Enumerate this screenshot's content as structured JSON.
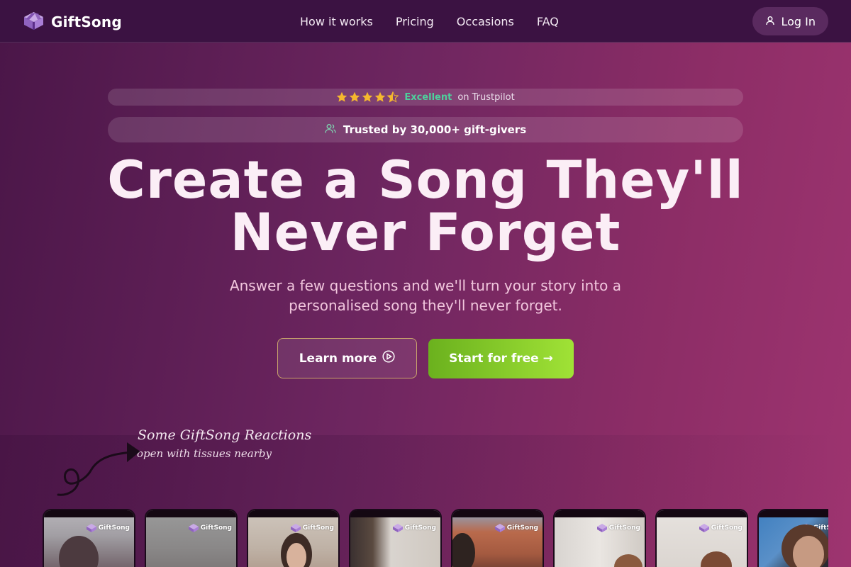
{
  "brand": {
    "name": "GiftSong"
  },
  "nav": {
    "links": [
      "How it works",
      "Pricing",
      "Occasions",
      "FAQ"
    ],
    "login_label": "Log In"
  },
  "trustpilot": {
    "rating_label": "Excellent",
    "source": "on Trustpilot",
    "rating_stars": 4.5
  },
  "trust_badge": {
    "text": "Trusted by 30,000+ gift-givers"
  },
  "hero": {
    "title_line1": "Create a Song They'll",
    "title_line2": "Never Forget",
    "subtitle": "Answer a few questions and we'll turn your story into a personalised song they'll never forget."
  },
  "buttons": {
    "learn_more": "Learn more",
    "start": "Start for free →"
  },
  "reactions": {
    "title": "Some GiftSong Reactions",
    "subtitle": "open with tissues nearby"
  },
  "video_cards": {
    "watermark": "GiftSong",
    "count": 8
  },
  "colors": {
    "accent_green": "#8fd22e",
    "excellent_green": "#4ecf9c",
    "star_yellow": "#f5b82e",
    "nav_bg": "#3b1242"
  }
}
